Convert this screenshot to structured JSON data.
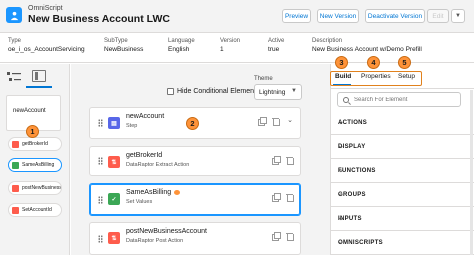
{
  "header": {
    "type_label": "OmniScript",
    "title": "New Business Account LWC",
    "buttons": {
      "preview": "Preview",
      "new_version": "New Version",
      "deactivate": "Deactivate Version",
      "edit": "Edit",
      "more": "▼"
    }
  },
  "highlights": [
    {
      "key": "Type",
      "value": "oe_i_os_AccountServicing"
    },
    {
      "key": "SubType",
      "value": "NewBusiness"
    },
    {
      "key": "Language",
      "value": "English"
    },
    {
      "key": "Version",
      "value": "1"
    },
    {
      "key": "Active",
      "value": "true"
    },
    {
      "key": "Description",
      "value": "New Business Account w/Demo Prefill"
    }
  ],
  "left_rail": {
    "root": "newAccount",
    "items": [
      {
        "label": "getBrokerId",
        "color": "#fe5c4c"
      },
      {
        "label": "SameAsBilling",
        "color": "#3ba755",
        "active": true
      },
      {
        "label": "postNewBusiness",
        "color": "#fe5c4c"
      },
      {
        "label": "SetAccountId",
        "color": "#fe5c4c"
      }
    ]
  },
  "canvas": {
    "hide_conditional_label": "Hide Conditional Elements",
    "theme_label": "Theme",
    "theme_value": "Lightning",
    "steps": [
      {
        "title": "newAccount",
        "subtitle": "Step",
        "icon_color": "#5867e8"
      },
      {
        "title": "getBrokerId",
        "subtitle": "DataRaptor Extract Action",
        "icon_color": "#fe5c4c"
      },
      {
        "title": "SameAsBilling",
        "subtitle": "Set Values",
        "icon_color": "#3ba755"
      },
      {
        "title": "postNewBusinessAccount",
        "subtitle": "DataRaptor Post Action",
        "icon_color": "#fe5c4c"
      }
    ]
  },
  "right_panel": {
    "tabs": {
      "build": "Build",
      "properties": "Properties",
      "setup": "Setup"
    },
    "search_placeholder": "Search For Element",
    "sections": [
      "ACTIONS",
      "DISPLAY",
      "FUNCTIONS",
      "GROUPS",
      "INPUTS",
      "OMNISCRIPTS"
    ]
  },
  "callouts": [
    "1",
    "2",
    "3",
    "4",
    "5"
  ]
}
